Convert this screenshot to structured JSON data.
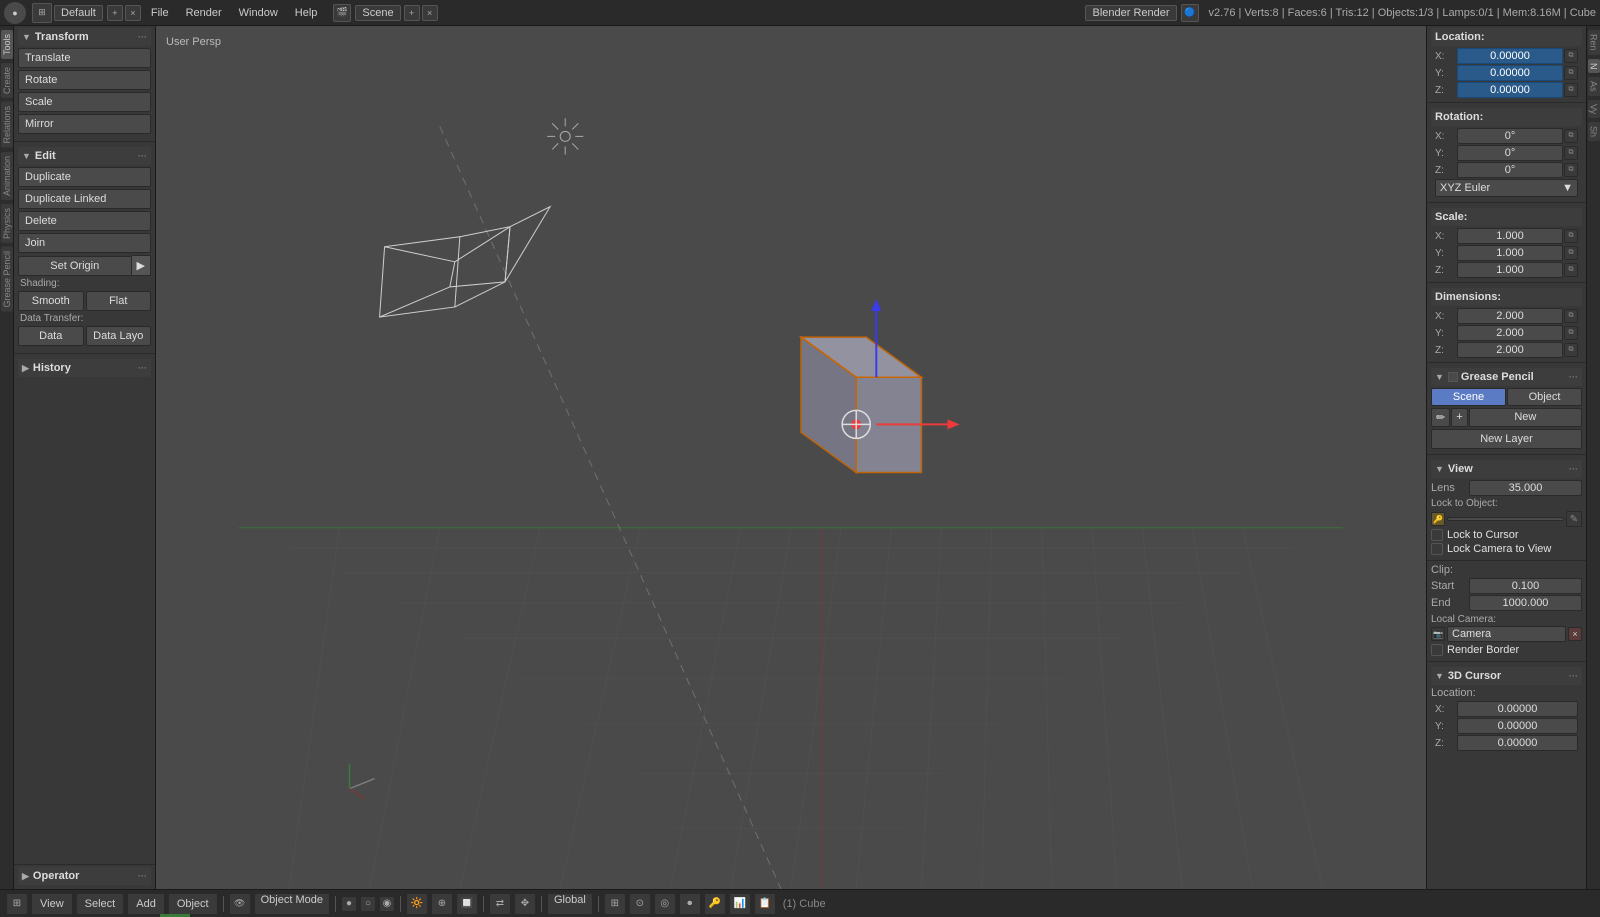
{
  "topbar": {
    "logo": "B",
    "menus": [
      "File",
      "Render",
      "Window",
      "Help"
    ],
    "layout": "Default",
    "scene": "Scene",
    "render_engine": "Blender Render",
    "version_info": "v2.76 | Verts:8 | Faces:6 | Tris:12 | Objects:1/3 | Lamps:0/1 | Mem:8.16M | Cube"
  },
  "left_panel": {
    "transform_header": "Transform",
    "transform_buttons": [
      "Translate",
      "Rotate",
      "Scale",
      "Mirror"
    ],
    "edit_header": "Edit",
    "edit_buttons": [
      "Duplicate",
      "Duplicate Linked",
      "Delete",
      "Join"
    ],
    "set_origin_label": "Set Origin",
    "shading_label": "Shading:",
    "smooth_label": "Smooth",
    "flat_label": "Flat",
    "data_transfer_label": "Data Transfer:",
    "data_label": "Data",
    "data_layers_label": "Data Layo",
    "history_header": "History"
  },
  "viewport": {
    "label": "User Persp"
  },
  "right_panel": {
    "location_header": "Location",
    "location": {
      "x_label": "X:",
      "x_value": "0.00000",
      "y_label": "Y:",
      "y_value": "0.00000",
      "z_label": "Z:",
      "z_value": "0.00000"
    },
    "rotation_header": "Rotation",
    "rotation": {
      "x_label": "X:",
      "x_value": "0°",
      "y_label": "Y:",
      "y_value": "0°",
      "z_label": "Z:",
      "z_value": "0°"
    },
    "rotation_mode": "XYZ Euler",
    "scale_header": "Scale",
    "scale": {
      "x_label": "X:",
      "x_value": "1.000",
      "y_label": "Y:",
      "y_value": "1.000",
      "z_label": "Z:",
      "z_value": "1.000"
    },
    "dimensions_header": "Dimensions",
    "dimensions": {
      "x_label": "X:",
      "x_value": "2.000",
      "y_label": "Y:",
      "y_value": "2.000",
      "z_label": "Z:",
      "z_value": "2.000"
    },
    "grease_pencil_header": "Grease Pencil",
    "gp_tab_scene": "Scene",
    "gp_tab_object": "Object",
    "gp_new_label": "New",
    "gp_new_layer_label": "New Layer",
    "view_header": "View",
    "lens_label": "Lens",
    "lens_value": "35.000",
    "lock_to_object_label": "Lock to Object:",
    "lock_to_cursor_label": "Lock to Cursor",
    "lock_camera_label": "Lock Camera to View",
    "clip_label": "Clip:",
    "clip_start_label": "Start",
    "clip_start_value": "0.100",
    "clip_end_label": "End",
    "clip_end_value": "1000.000",
    "local_camera_label": "Local Camera:",
    "camera_value": "Camera",
    "render_border_label": "Render Border",
    "cursor_3d_header": "3D Cursor",
    "cursor_location_label": "Location:",
    "cursor_x_label": "X:",
    "cursor_x_value": "0.00000",
    "cursor_y_label": "Y:",
    "cursor_y_value": "0.00000",
    "cursor_z_label": "Z:",
    "cursor_z_value": "0.00000"
  },
  "bottom_bar": {
    "view_label": "View",
    "select_label": "Select",
    "add_label": "Add",
    "object_label": "Object",
    "mode_label": "Object Mode",
    "object_info": "(1) Cube",
    "shading_labels": [
      "",
      "",
      "",
      ""
    ],
    "global_label": "Global"
  }
}
